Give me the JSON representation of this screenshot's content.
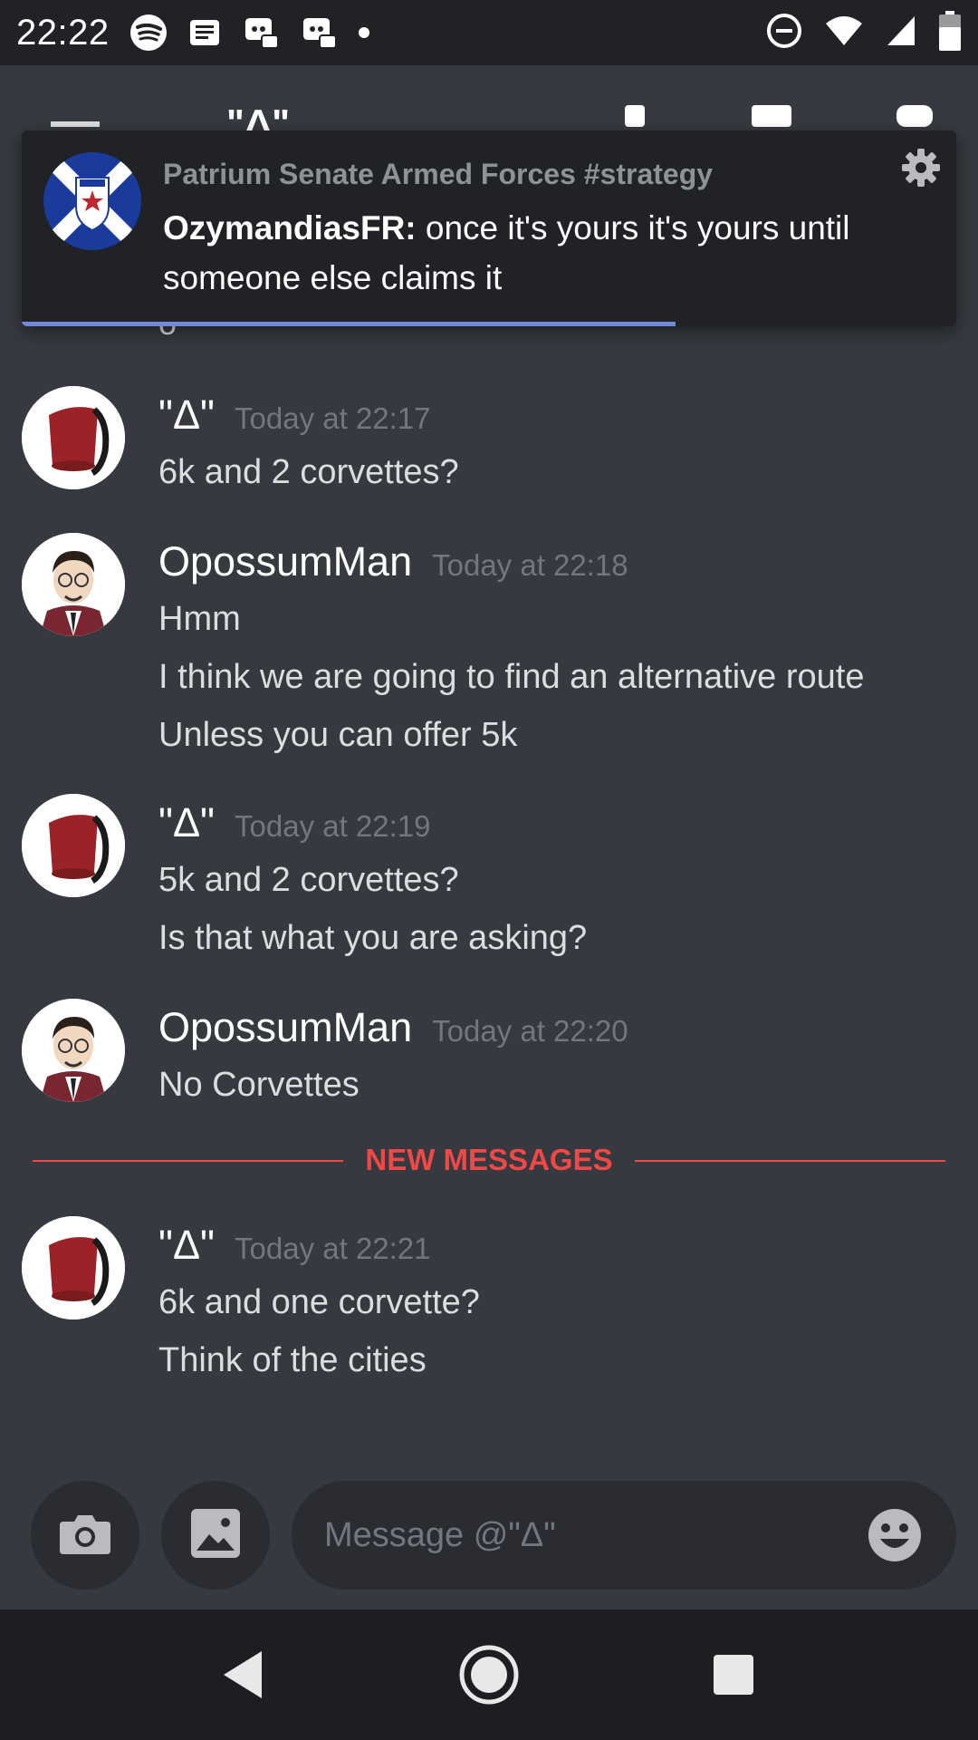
{
  "status_bar": {
    "time": "22:22",
    "left_icons": [
      "spotify-icon",
      "news-icon",
      "discord-icon",
      "discord-icon",
      "dot-icon"
    ],
    "right_icons": [
      "do-not-disturb-icon",
      "wifi-icon",
      "signal-icon",
      "battery-icon"
    ]
  },
  "header": {
    "channel_name_partial": "\"Δ\""
  },
  "notification": {
    "title": "Patrium Senate Armed Forces #strategy",
    "author": "OzymandiasFR:",
    "text": "once it's yours it's yours until someone else claims it",
    "progress": 0.7
  },
  "chat": {
    "cut_text": "o",
    "messages": [
      {
        "author": "\"Δ\"",
        "timestamp": "Today at 22:17",
        "lines": [
          "6k and 2 corvettes?"
        ]
      },
      {
        "author": "OpossumMan",
        "timestamp": "Today at 22:18",
        "lines": [
          "Hmm",
          "I think we are going to find an alternative route",
          "Unless you can offer 5k"
        ]
      },
      {
        "author": "\"Δ\"",
        "timestamp": "Today at 22:19",
        "lines": [
          "5k and 2 corvettes?",
          "Is that what you are asking?"
        ]
      },
      {
        "author": "OpossumMan",
        "timestamp": "Today at 22:20",
        "lines": [
          "No Corvettes"
        ]
      },
      {
        "author": "\"Δ\"",
        "timestamp": "Today at 22:21",
        "lines": [
          "6k and one corvette?",
          "Think of the cities"
        ]
      }
    ],
    "new_messages_label": "NEW MESSAGES"
  },
  "input": {
    "placeholder": "Message @\"Δ\""
  },
  "colors": {
    "background": "#36393f",
    "notification_bg": "#202225",
    "accent": "#7289da",
    "new_messages": "#f04747"
  }
}
